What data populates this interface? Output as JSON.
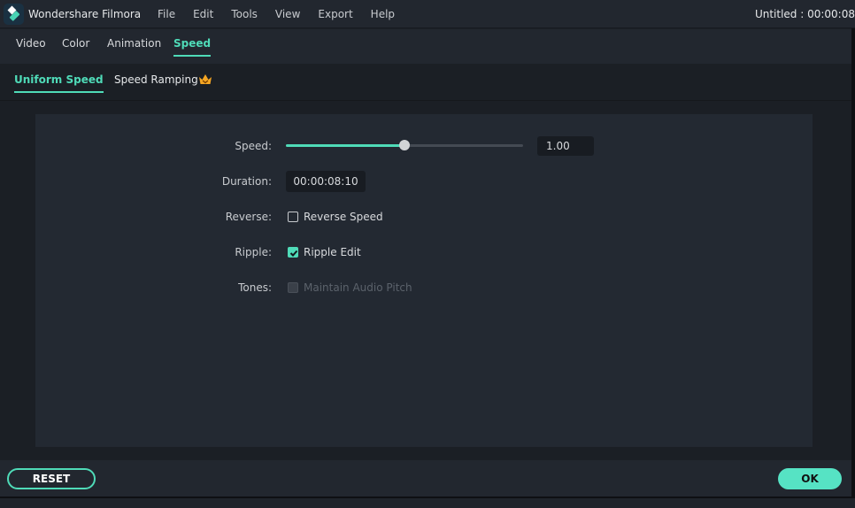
{
  "app": {
    "title": "Wondershare Filmora",
    "document_title": "Untitled : 00:00:08"
  },
  "menu": [
    "File",
    "Edit",
    "Tools",
    "View",
    "Export",
    "Help"
  ],
  "tabs": [
    {
      "label": "Video",
      "active": false
    },
    {
      "label": "Color",
      "active": false
    },
    {
      "label": "Animation",
      "active": false
    },
    {
      "label": "Speed",
      "active": true
    }
  ],
  "subtabs": [
    {
      "label": "Uniform Speed",
      "active": true
    },
    {
      "label": "Speed Ramping",
      "active": false,
      "icon": "crown-icon"
    }
  ],
  "speed": {
    "label": "Speed:",
    "value": "1.00",
    "slider_fraction": 0.5
  },
  "duration": {
    "label": "Duration:",
    "value": "00:00:08:10"
  },
  "reverse": {
    "label": "Reverse:",
    "checkbox_label": "Reverse Speed",
    "checked": false
  },
  "ripple": {
    "label": "Ripple:",
    "checkbox_label": "Ripple Edit",
    "checked": true
  },
  "tones": {
    "label": "Tones:",
    "checkbox_label": "Maintain Audio Pitch",
    "checked": false,
    "disabled": true
  },
  "footer": {
    "reset_label": "RESET",
    "ok_label": "OK"
  },
  "colors": {
    "accent": "#4fdbb8",
    "ok_button": "#56e3c4",
    "crown": "#f5a623"
  }
}
